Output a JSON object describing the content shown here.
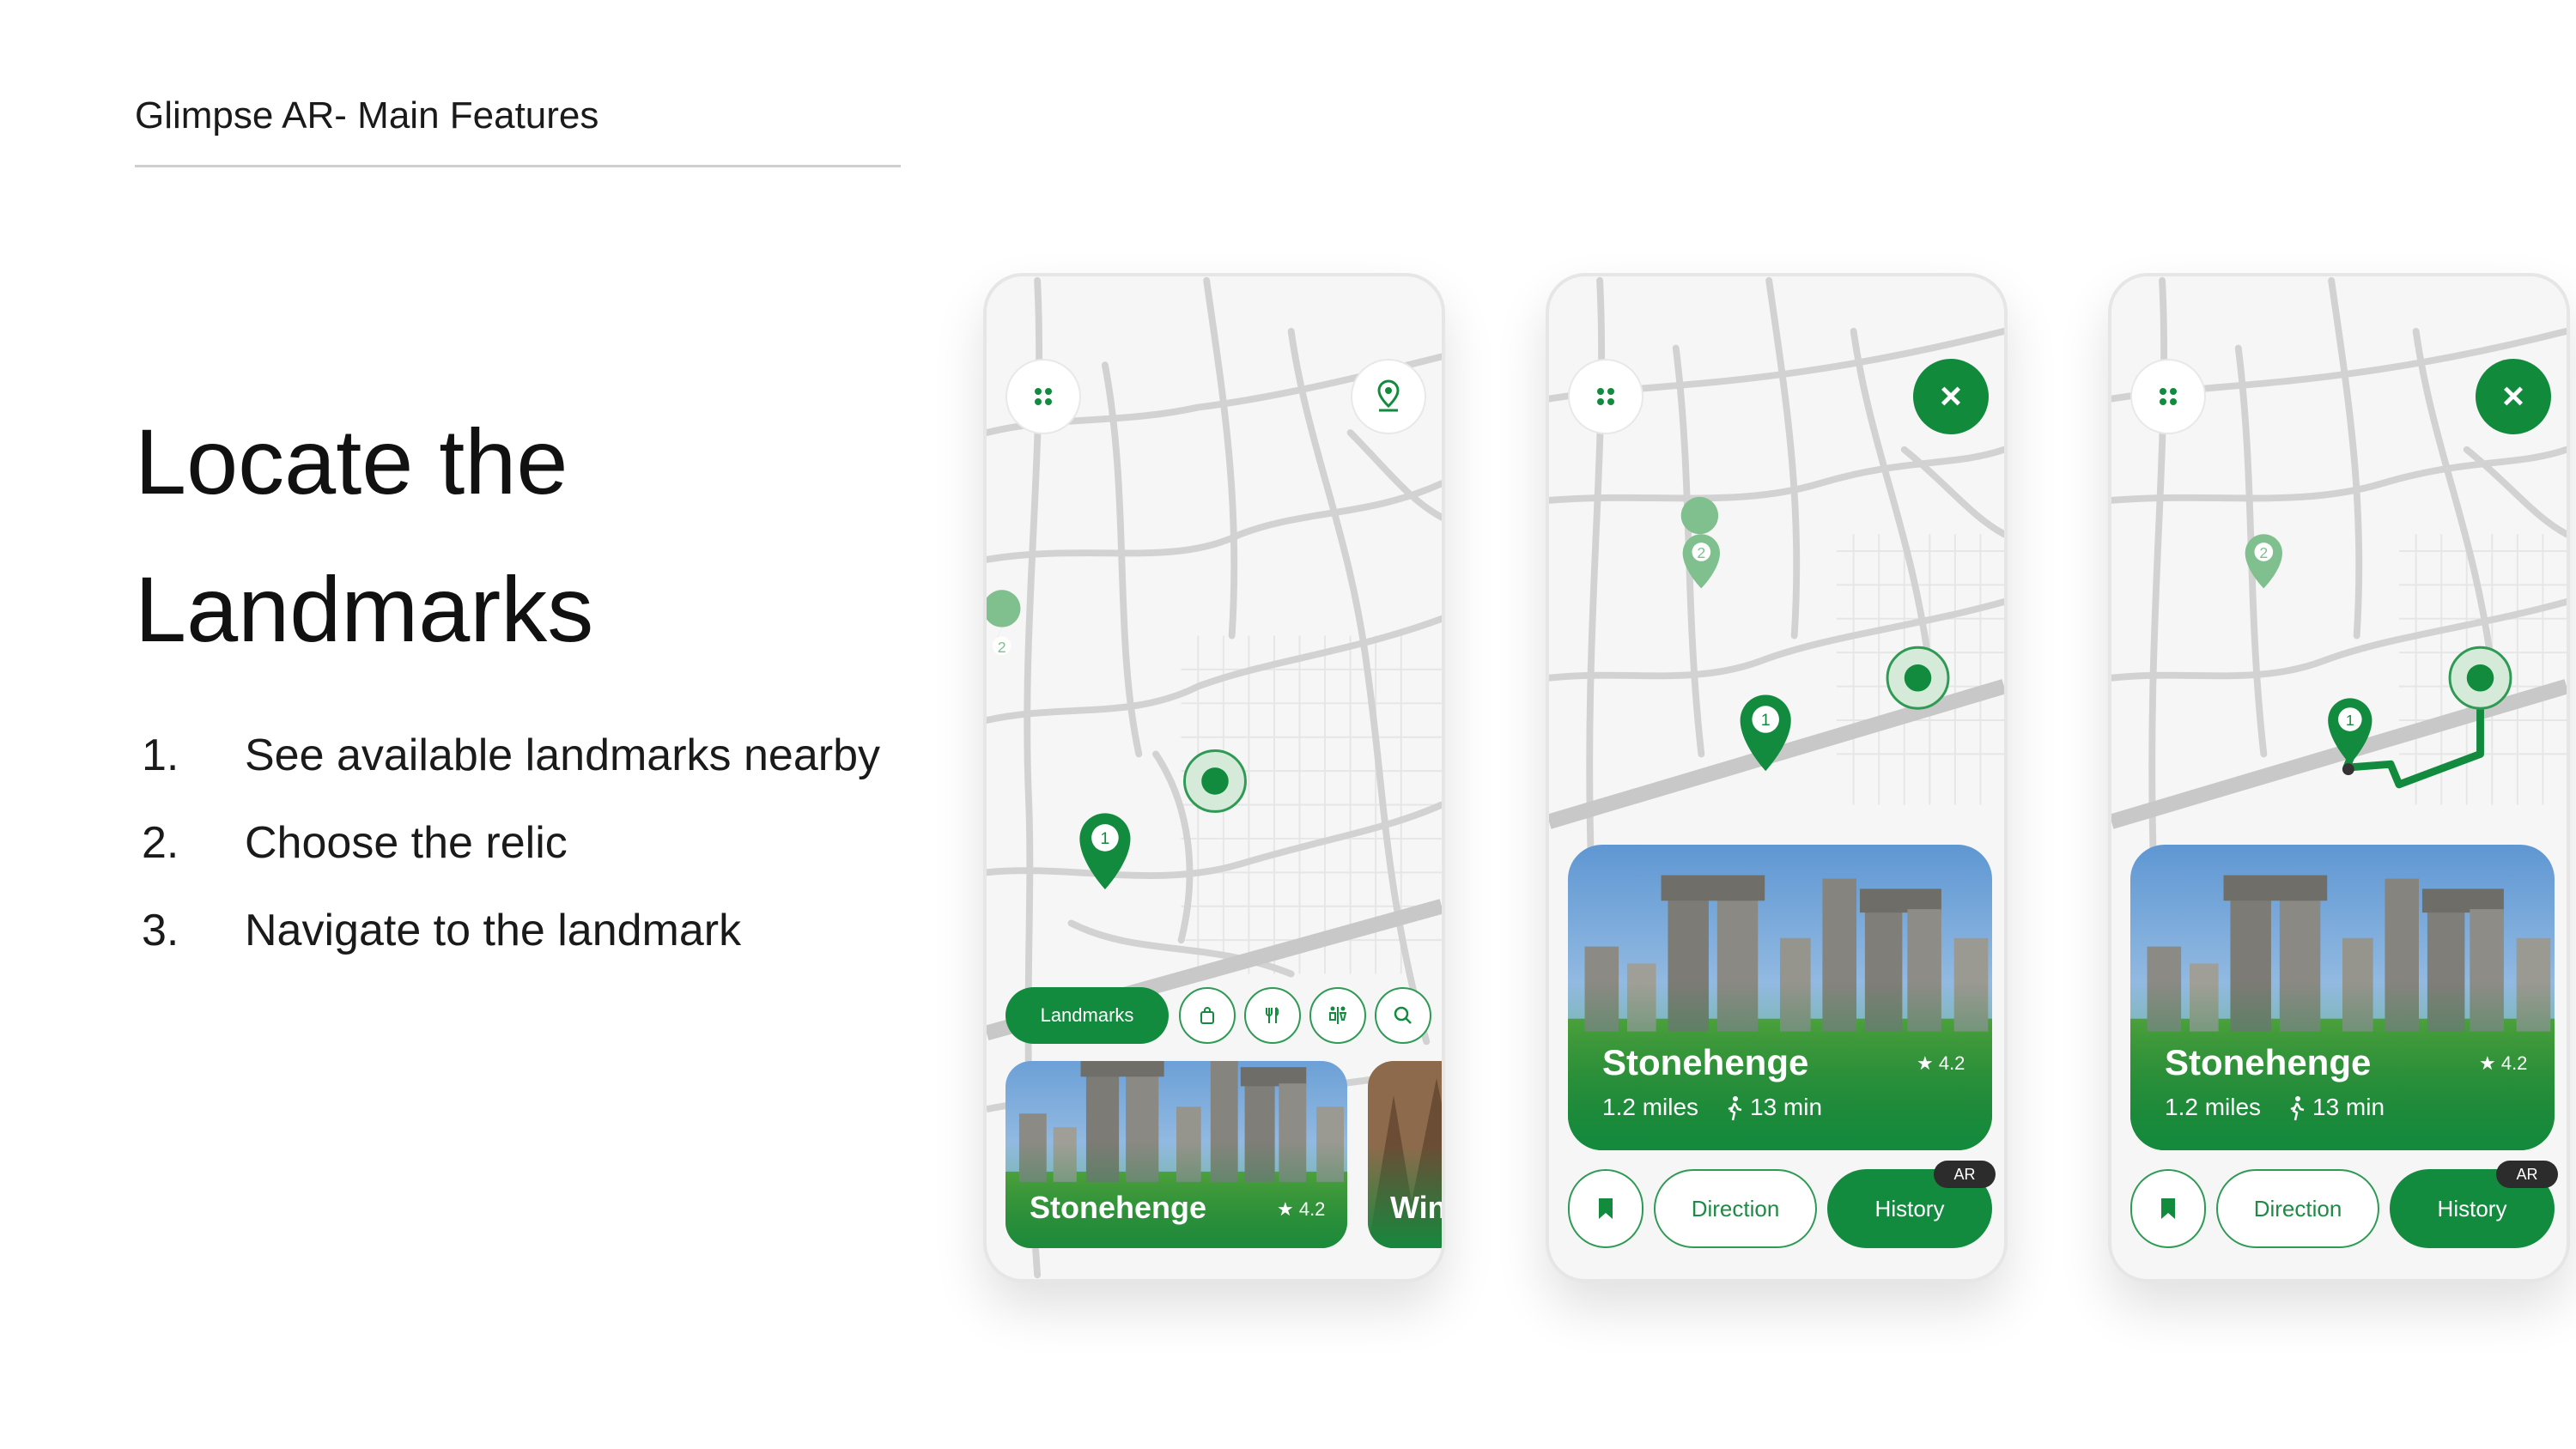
{
  "header": {
    "title": "Glimpse AR- Main Features"
  },
  "slide": {
    "headline_line1": "Locate the",
    "headline_line2": "Landmarks",
    "features": [
      {
        "num": "1.",
        "text": "See available landmarks nearby"
      },
      {
        "num": "2.",
        "text": "Choose the relic"
      },
      {
        "num": "3.",
        "text": "Navigate to the landmark"
      }
    ]
  },
  "screen1": {
    "chips": {
      "primary_label": "Landmarks",
      "icons": [
        "shopping-bag-icon",
        "restaurant-icon",
        "restroom-icon",
        "search-icon"
      ]
    },
    "card": {
      "title": "Stonehenge",
      "rating": "★ 4.2"
    },
    "peek_card": {
      "title": "Win"
    },
    "markers": [
      "1",
      "2"
    ]
  },
  "screen2": {
    "card": {
      "title": "Stonehenge",
      "rating": "★ 4.2",
      "distance": "1.2 miles",
      "time": "13 min"
    },
    "actions": {
      "direction": "Direction",
      "history": "History",
      "ar_badge": "AR"
    },
    "markers": [
      "1",
      "2"
    ]
  },
  "screen3": {
    "card": {
      "title": "Stonehenge",
      "rating": "★ 4.2",
      "distance": "1.2 miles",
      "time": "13 min"
    },
    "actions": {
      "direction": "Direction",
      "history": "History",
      "ar_badge": "AR"
    },
    "markers": [
      "1",
      "2"
    ]
  },
  "colors": {
    "brand_green": "#128b3e",
    "road_gray": "#d4d4d4",
    "text_dark": "#111111"
  }
}
